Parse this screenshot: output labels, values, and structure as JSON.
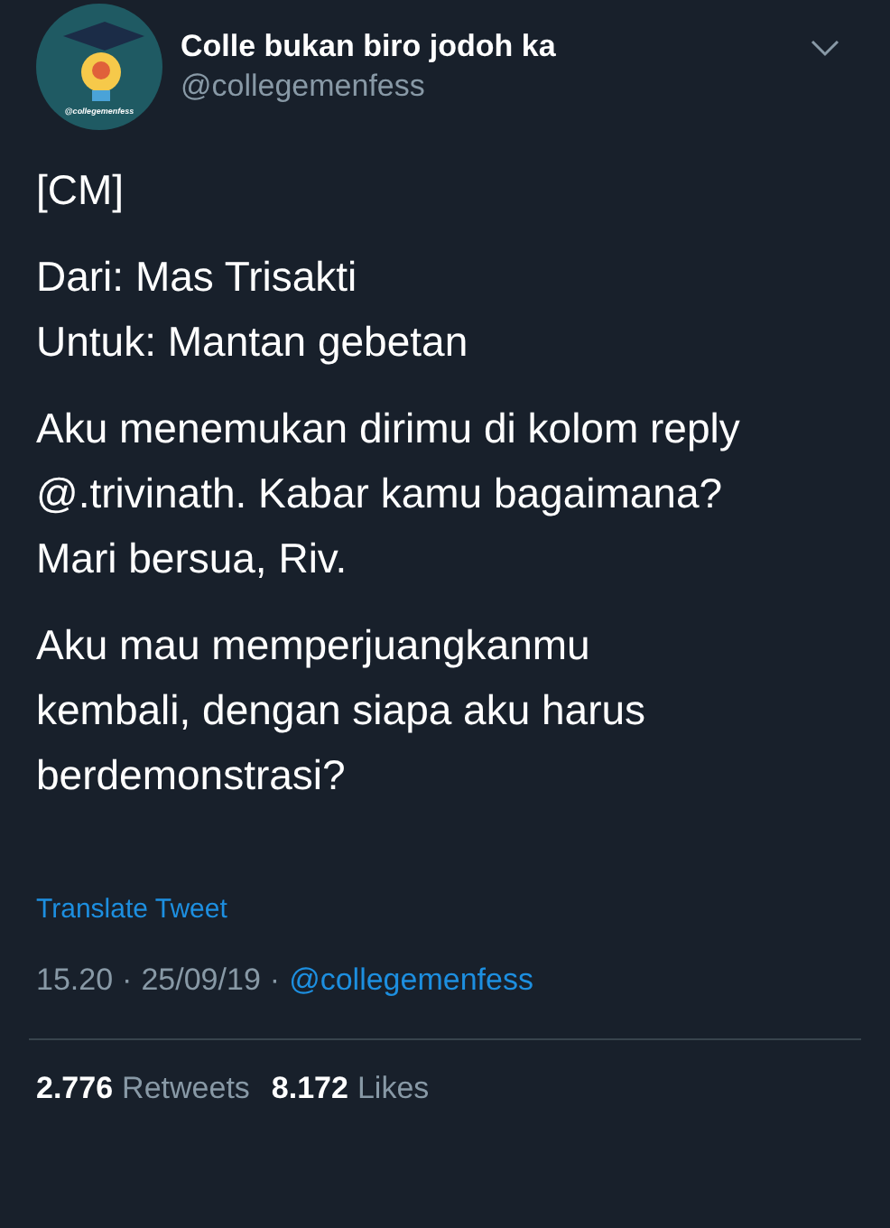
{
  "author": {
    "name": "Colle bukan biro jodoh ka",
    "handle": "@collegemenfess",
    "avatar_label": "@collegemenfess"
  },
  "paragraphs": [
    [
      "[CM]"
    ],
    [
      "Dari: Mas Trisakti",
      "Untuk: Mantan gebetan"
    ],
    [
      "Aku menemukan dirimu di kolom reply",
      "@.trivinath. Kabar kamu bagaimana?",
      "Mari bersua, Riv."
    ],
    [
      "Aku mau memperjuangkanmu",
      "kembali, dengan siapa aku harus",
      "berdemonstrasi?"
    ]
  ],
  "translate": "Translate Tweet",
  "meta": {
    "time": "15.20",
    "separator": "·",
    "date": "25/09/19",
    "separator_2": "·",
    "via": "@collegemenfess"
  },
  "stats": [
    {
      "count": "2.776",
      "label": "Retweets"
    },
    {
      "count": "8.172",
      "label": "Likes"
    }
  ]
}
